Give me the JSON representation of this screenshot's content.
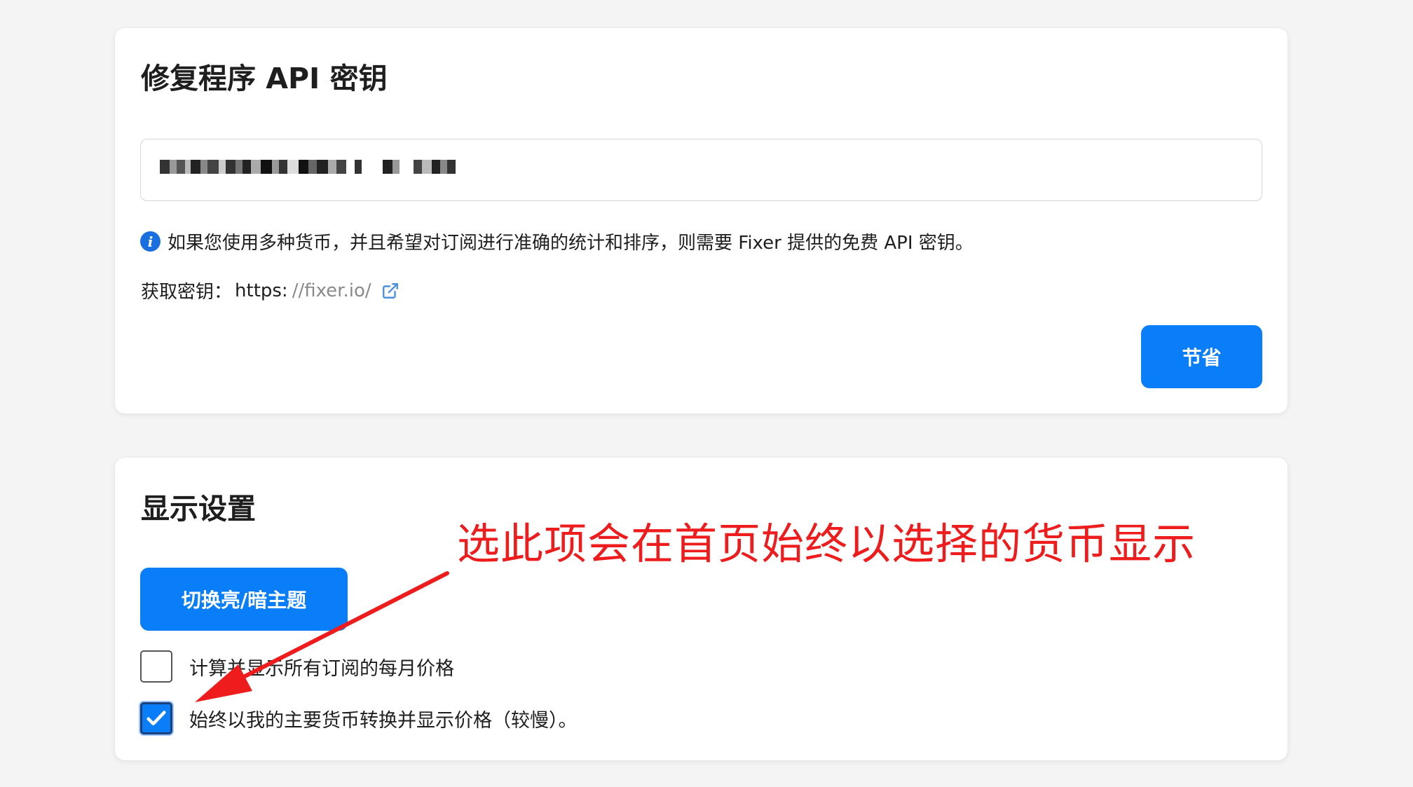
{
  "api_card": {
    "title": "修复程序 API 密钥",
    "key_value": "",
    "info_text": "如果您使用多种货币，并且希望对订阅进行准确的统计和排序，则需要 Fixer 提供的免费 API 密钥。",
    "get_key_label": "获取密钥：",
    "get_key_https": "https:",
    "get_key_link": "//fixer.io/",
    "save_label": "节省"
  },
  "display_card": {
    "title": "显示设置",
    "theme_button_label": "切换亮/暗主题",
    "checkbox_monthly": {
      "label": "计算并显示所有订阅的每月价格",
      "checked": false
    },
    "checkbox_convert": {
      "label": "始终以我的主要货币转换并显示价格（较慢）。",
      "checked": true
    }
  },
  "annotation": {
    "text": "选此项会在首页始终以选择的货币显示",
    "color": "#ee1c1c"
  },
  "colors": {
    "accent": "#0a7df8",
    "info_icon": "#1a6fe0"
  },
  "icons": {
    "info": "info-icon",
    "external_link": "external-link-icon",
    "check": "checkmark-icon"
  }
}
